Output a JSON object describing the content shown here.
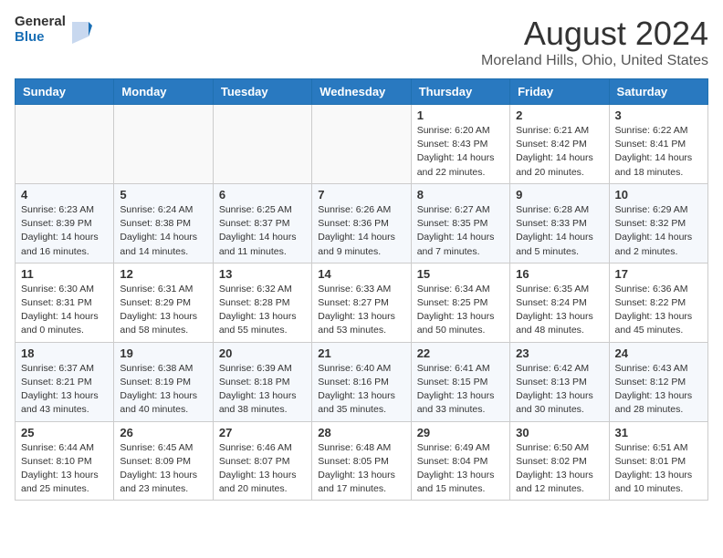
{
  "logo": {
    "text_general": "General",
    "text_blue": "Blue"
  },
  "title": "August 2024",
  "location": "Moreland Hills, Ohio, United States",
  "headers": [
    "Sunday",
    "Monday",
    "Tuesday",
    "Wednesday",
    "Thursday",
    "Friday",
    "Saturday"
  ],
  "weeks": [
    [
      {
        "day": "",
        "info": ""
      },
      {
        "day": "",
        "info": ""
      },
      {
        "day": "",
        "info": ""
      },
      {
        "day": "",
        "info": ""
      },
      {
        "day": "1",
        "info": "Sunrise: 6:20 AM\nSunset: 8:43 PM\nDaylight: 14 hours\nand 22 minutes."
      },
      {
        "day": "2",
        "info": "Sunrise: 6:21 AM\nSunset: 8:42 PM\nDaylight: 14 hours\nand 20 minutes."
      },
      {
        "day": "3",
        "info": "Sunrise: 6:22 AM\nSunset: 8:41 PM\nDaylight: 14 hours\nand 18 minutes."
      }
    ],
    [
      {
        "day": "4",
        "info": "Sunrise: 6:23 AM\nSunset: 8:39 PM\nDaylight: 14 hours\nand 16 minutes."
      },
      {
        "day": "5",
        "info": "Sunrise: 6:24 AM\nSunset: 8:38 PM\nDaylight: 14 hours\nand 14 minutes."
      },
      {
        "day": "6",
        "info": "Sunrise: 6:25 AM\nSunset: 8:37 PM\nDaylight: 14 hours\nand 11 minutes."
      },
      {
        "day": "7",
        "info": "Sunrise: 6:26 AM\nSunset: 8:36 PM\nDaylight: 14 hours\nand 9 minutes."
      },
      {
        "day": "8",
        "info": "Sunrise: 6:27 AM\nSunset: 8:35 PM\nDaylight: 14 hours\nand 7 minutes."
      },
      {
        "day": "9",
        "info": "Sunrise: 6:28 AM\nSunset: 8:33 PM\nDaylight: 14 hours\nand 5 minutes."
      },
      {
        "day": "10",
        "info": "Sunrise: 6:29 AM\nSunset: 8:32 PM\nDaylight: 14 hours\nand 2 minutes."
      }
    ],
    [
      {
        "day": "11",
        "info": "Sunrise: 6:30 AM\nSunset: 8:31 PM\nDaylight: 14 hours\nand 0 minutes."
      },
      {
        "day": "12",
        "info": "Sunrise: 6:31 AM\nSunset: 8:29 PM\nDaylight: 13 hours\nand 58 minutes."
      },
      {
        "day": "13",
        "info": "Sunrise: 6:32 AM\nSunset: 8:28 PM\nDaylight: 13 hours\nand 55 minutes."
      },
      {
        "day": "14",
        "info": "Sunrise: 6:33 AM\nSunset: 8:27 PM\nDaylight: 13 hours\nand 53 minutes."
      },
      {
        "day": "15",
        "info": "Sunrise: 6:34 AM\nSunset: 8:25 PM\nDaylight: 13 hours\nand 50 minutes."
      },
      {
        "day": "16",
        "info": "Sunrise: 6:35 AM\nSunset: 8:24 PM\nDaylight: 13 hours\nand 48 minutes."
      },
      {
        "day": "17",
        "info": "Sunrise: 6:36 AM\nSunset: 8:22 PM\nDaylight: 13 hours\nand 45 minutes."
      }
    ],
    [
      {
        "day": "18",
        "info": "Sunrise: 6:37 AM\nSunset: 8:21 PM\nDaylight: 13 hours\nand 43 minutes."
      },
      {
        "day": "19",
        "info": "Sunrise: 6:38 AM\nSunset: 8:19 PM\nDaylight: 13 hours\nand 40 minutes."
      },
      {
        "day": "20",
        "info": "Sunrise: 6:39 AM\nSunset: 8:18 PM\nDaylight: 13 hours\nand 38 minutes."
      },
      {
        "day": "21",
        "info": "Sunrise: 6:40 AM\nSunset: 8:16 PM\nDaylight: 13 hours\nand 35 minutes."
      },
      {
        "day": "22",
        "info": "Sunrise: 6:41 AM\nSunset: 8:15 PM\nDaylight: 13 hours\nand 33 minutes."
      },
      {
        "day": "23",
        "info": "Sunrise: 6:42 AM\nSunset: 8:13 PM\nDaylight: 13 hours\nand 30 minutes."
      },
      {
        "day": "24",
        "info": "Sunrise: 6:43 AM\nSunset: 8:12 PM\nDaylight: 13 hours\nand 28 minutes."
      }
    ],
    [
      {
        "day": "25",
        "info": "Sunrise: 6:44 AM\nSunset: 8:10 PM\nDaylight: 13 hours\nand 25 minutes."
      },
      {
        "day": "26",
        "info": "Sunrise: 6:45 AM\nSunset: 8:09 PM\nDaylight: 13 hours\nand 23 minutes."
      },
      {
        "day": "27",
        "info": "Sunrise: 6:46 AM\nSunset: 8:07 PM\nDaylight: 13 hours\nand 20 minutes."
      },
      {
        "day": "28",
        "info": "Sunrise: 6:48 AM\nSunset: 8:05 PM\nDaylight: 13 hours\nand 17 minutes."
      },
      {
        "day": "29",
        "info": "Sunrise: 6:49 AM\nSunset: 8:04 PM\nDaylight: 13 hours\nand 15 minutes."
      },
      {
        "day": "30",
        "info": "Sunrise: 6:50 AM\nSunset: 8:02 PM\nDaylight: 13 hours\nand 12 minutes."
      },
      {
        "day": "31",
        "info": "Sunrise: 6:51 AM\nSunset: 8:01 PM\nDaylight: 13 hours\nand 10 minutes."
      }
    ]
  ]
}
